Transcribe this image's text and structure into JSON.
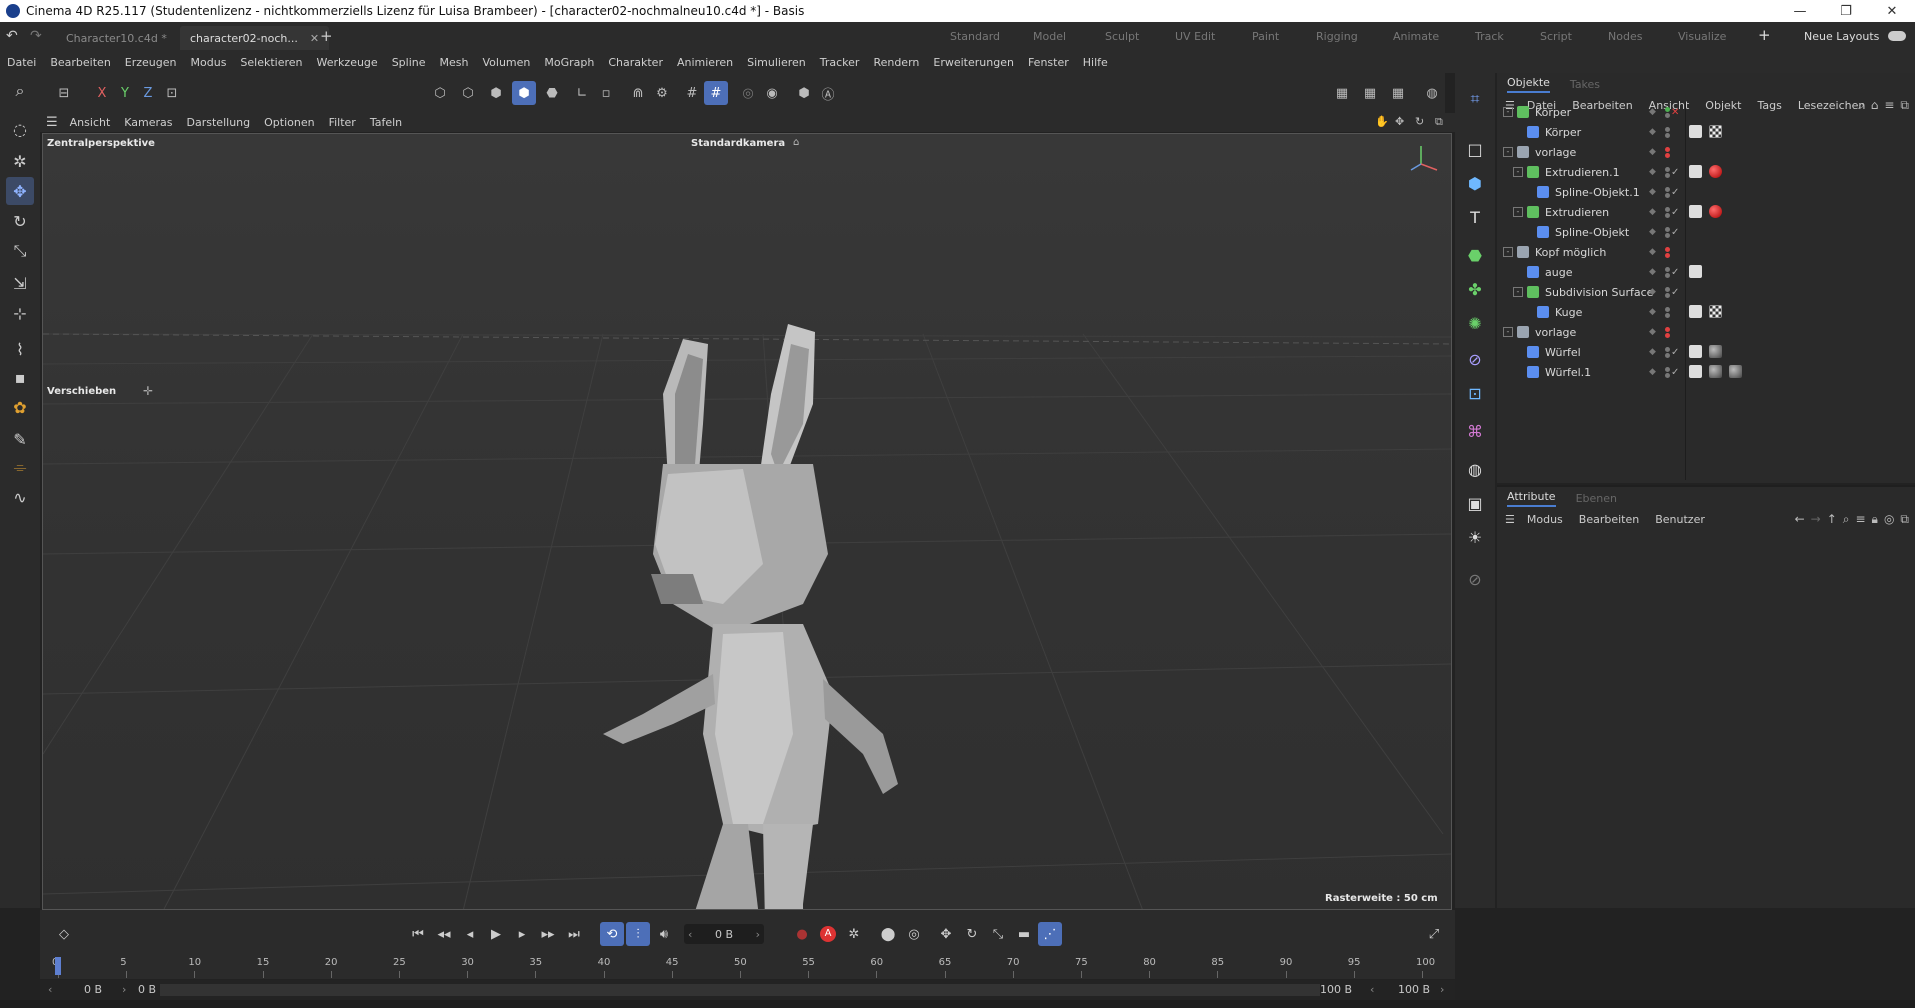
{
  "window": {
    "title": "Cinema 4D R25.117 (Studentenlizenz - nichtkommerziells Lizenz für Luisa Brambeer) - [character02-nochmalneu10.c4d *] - Basis"
  },
  "doc_tabs": [
    "Character10.c4d *",
    "character02-noch..."
  ],
  "layouts": [
    "Standard",
    "Model",
    "Sculpt",
    "UV Edit",
    "Paint",
    "Rigging",
    "Animate",
    "Track",
    "Script",
    "Nodes",
    "Visualize"
  ],
  "neue_layouts": "Neue Layouts",
  "menu": [
    "Datei",
    "Bearbeiten",
    "Erzeugen",
    "Modus",
    "Selektieren",
    "Werkzeuge",
    "Spline",
    "Mesh",
    "Volumen",
    "MoGraph",
    "Charakter",
    "Animieren",
    "Simulieren",
    "Tracker",
    "Rendern",
    "Erweiterungen",
    "Fenster",
    "Hilfe"
  ],
  "axes": {
    "x": "X",
    "y": "Y",
    "z": "Z"
  },
  "viewport_menu": [
    "Ansicht",
    "Kameras",
    "Darstellung",
    "Optionen",
    "Filter",
    "Tafeln"
  ],
  "viewport": {
    "perspective": "Zentralperspektive",
    "camera": "Standardkamera",
    "tool_label": "Verschieben",
    "grid_label": "Rasterweite : 50 cm"
  },
  "objects_panel": {
    "tabs": [
      "Objekte",
      "Takes"
    ],
    "menu": [
      "Datei",
      "Bearbeiten",
      "Ansicht",
      "Objekt",
      "Tags",
      "Lesezeichen"
    ],
    "rows": [
      {
        "name": "Körper",
        "indent": 0,
        "expand": "-",
        "icon_color": "#5fbf5f",
        "flag": "x"
      },
      {
        "name": "Körper",
        "indent": 1,
        "expand": "",
        "icon_color": "#5b8ef0",
        "flag": "",
        "tags": [
          "white",
          "checker"
        ]
      },
      {
        "name": "vorlage",
        "indent": 0,
        "expand": "-",
        "icon_color": "#9aa4b0",
        "flag": "red"
      },
      {
        "name": "Extrudieren.1",
        "indent": 1,
        "expand": "-",
        "icon_color": "#5fbf5f",
        "flag": "check",
        "tags": [
          "white",
          "red"
        ]
      },
      {
        "name": "Spline-Objekt.1",
        "indent": 2,
        "expand": "",
        "icon_color": "#5b8ef0",
        "flag": "check"
      },
      {
        "name": "Extrudieren",
        "indent": 1,
        "expand": "-",
        "icon_color": "#5fbf5f",
        "flag": "check",
        "tags": [
          "white",
          "red"
        ]
      },
      {
        "name": "Spline-Objekt",
        "indent": 2,
        "expand": "",
        "icon_color": "#5b8ef0",
        "flag": "check"
      },
      {
        "name": "Kopf möglich",
        "indent": 0,
        "expand": "-",
        "icon_color": "#9aa4b0",
        "flag": "red"
      },
      {
        "name": "auge",
        "indent": 1,
        "expand": "",
        "icon_color": "#5b8ef0",
        "flag": "check",
        "tags": [
          "white"
        ]
      },
      {
        "name": "Subdivision Surface",
        "indent": 1,
        "expand": "-",
        "icon_color": "#5fbf5f",
        "flag": "check"
      },
      {
        "name": "Kuge",
        "indent": 2,
        "expand": "",
        "icon_color": "#5b8ef0",
        "flag": "",
        "tags": [
          "white",
          "checker"
        ]
      },
      {
        "name": "vorlage",
        "indent": 0,
        "expand": "-",
        "icon_color": "#9aa4b0",
        "flag": "red"
      },
      {
        "name": "Würfel",
        "indent": 1,
        "expand": "",
        "icon_color": "#5b8ef0",
        "flag": "check",
        "tags": [
          "white",
          "sphere"
        ]
      },
      {
        "name": "Würfel.1",
        "indent": 1,
        "expand": "",
        "icon_color": "#5b8ef0",
        "flag": "check",
        "tags": [
          "white",
          "sphere",
          "sphere"
        ]
      }
    ]
  },
  "attributes_panel": {
    "tabs": [
      "Attribute",
      "Ebenen"
    ],
    "menu": [
      "Modus",
      "Bearbeiten",
      "Benutzer"
    ]
  },
  "timeline": {
    "frame_field": "0 B",
    "ruler_ticks": [
      "0",
      "5",
      "10",
      "15",
      "20",
      "25",
      "30",
      "35",
      "40",
      "45",
      "50",
      "55",
      "60",
      "65",
      "70",
      "75",
      "80",
      "85",
      "90",
      "95",
      "100"
    ],
    "start": "0 B",
    "start2": "0 B",
    "end": "100 B",
    "end2": "100 B"
  }
}
